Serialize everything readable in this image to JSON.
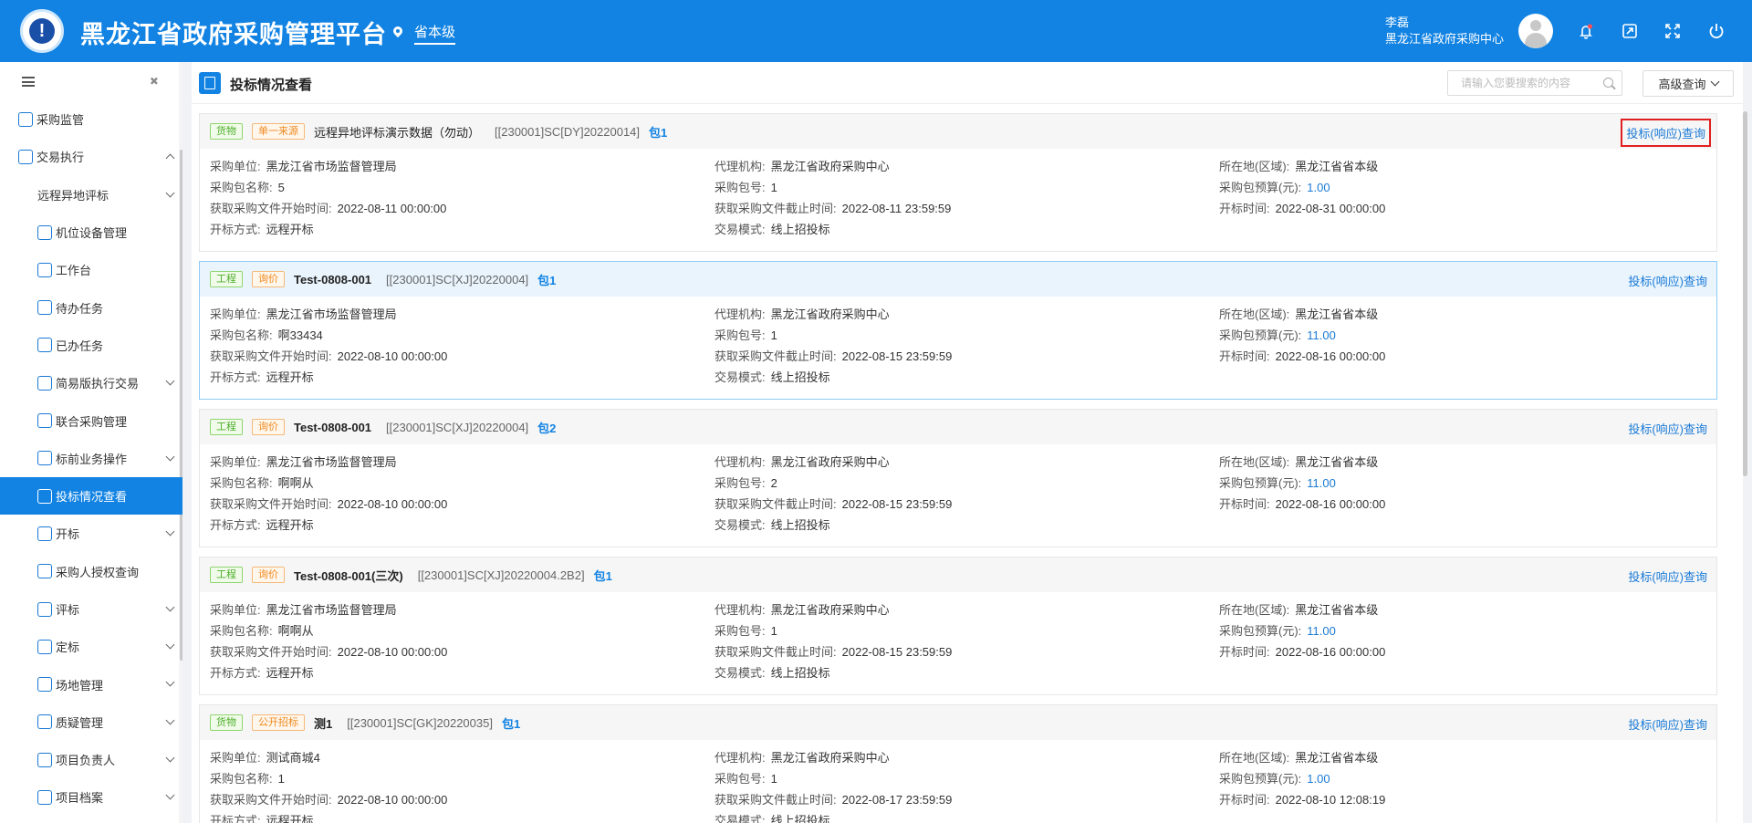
{
  "header": {
    "app_title": "黑龙江省政府采购管理平台",
    "region": "省本级",
    "user_name": "李磊",
    "user_org": "黑龙江省政府采购中心"
  },
  "sidebar": {
    "items": [
      {
        "label": "采购监管",
        "level": 0,
        "caret": ""
      },
      {
        "label": "交易执行",
        "level": 0,
        "caret": "up"
      },
      {
        "label": "远程异地评标",
        "level": 1,
        "caret": "down",
        "noicon": true
      },
      {
        "label": "机位设备管理",
        "level": 1,
        "caret": ""
      },
      {
        "label": "工作台",
        "level": 1,
        "caret": ""
      },
      {
        "label": "待办任务",
        "level": 1,
        "caret": ""
      },
      {
        "label": "已办任务",
        "level": 1,
        "caret": ""
      },
      {
        "label": "简易版执行交易",
        "level": 1,
        "caret": "down"
      },
      {
        "label": "联合采购管理",
        "level": 1,
        "caret": ""
      },
      {
        "label": "标前业务操作",
        "level": 1,
        "caret": "down"
      },
      {
        "label": "投标情况查看",
        "level": 1,
        "caret": "",
        "active": true
      },
      {
        "label": "开标",
        "level": 1,
        "caret": "down"
      },
      {
        "label": "采购人授权查询",
        "level": 1,
        "caret": ""
      },
      {
        "label": "评标",
        "level": 1,
        "caret": "down"
      },
      {
        "label": "定标",
        "level": 1,
        "caret": "down"
      },
      {
        "label": "场地管理",
        "level": 1,
        "caret": "down"
      },
      {
        "label": "质疑管理",
        "level": 1,
        "caret": "down"
      },
      {
        "label": "项目负责人",
        "level": 1,
        "caret": "down"
      },
      {
        "label": "项目档案",
        "level": 1,
        "caret": "down"
      }
    ]
  },
  "page": {
    "title": "投标情况查看",
    "search_placeholder": "请输入您要搜索的内容",
    "advanced_label": "高级查询"
  },
  "labels": {
    "unit": "采购单位:",
    "pkg_name": "采购包名称:",
    "start_time": "获取采购文件开始时间:",
    "open_mode": "开标方式:",
    "agency": "代理机构:",
    "pkg_no": "采购包号:",
    "end_time": "获取采购文件截止时间:",
    "trade_mode": "交易模式:",
    "region": "所在地(区域):",
    "budget": "采购包预算(元):",
    "open_time": "开标时间:",
    "query": "投标(响应)查询"
  },
  "cards": [
    {
      "tag1": "货物",
      "tag2": "单一来源",
      "name": "远程异地评标演示数据（勿动）",
      "code": "[[230001]SC[DY]20220014]",
      "pkg": "包1",
      "unit": "黑龙江省市场监督管理局",
      "pkg_name": "5",
      "start_time": "2022-08-11 00:00:00",
      "open_mode": "远程开标",
      "agency": "黑龙江省政府采购中心",
      "pkg_no": "1",
      "end_time": "2022-08-11 23:59:59",
      "trade_mode": "线上招投标",
      "region": "黑龙江省省本级",
      "budget": "1.00",
      "open_time": "2022-08-31 00:00:00",
      "bold": false,
      "boxed": true,
      "selected": false
    },
    {
      "tag1": "工程",
      "tag2": "询价",
      "name": "Test-0808-001",
      "code": "[[230001]SC[XJ]20220004]",
      "pkg": "包1",
      "unit": "黑龙江省市场监督管理局",
      "pkg_name": "啊33434",
      "start_time": "2022-08-10 00:00:00",
      "open_mode": "远程开标",
      "agency": "黑龙江省政府采购中心",
      "pkg_no": "1",
      "end_time": "2022-08-15 23:59:59",
      "trade_mode": "线上招投标",
      "region": "黑龙江省省本级",
      "budget": "11.00",
      "open_time": "2022-08-16 00:00:00",
      "bold": true,
      "boxed": false,
      "selected": true
    },
    {
      "tag1": "工程",
      "tag2": "询价",
      "name": "Test-0808-001",
      "code": "[[230001]SC[XJ]20220004]",
      "pkg": "包2",
      "unit": "黑龙江省市场监督管理局",
      "pkg_name": "啊啊从",
      "start_time": "2022-08-10 00:00:00",
      "open_mode": "远程开标",
      "agency": "黑龙江省政府采购中心",
      "pkg_no": "2",
      "end_time": "2022-08-15 23:59:59",
      "trade_mode": "线上招投标",
      "region": "黑龙江省省本级",
      "budget": "11.00",
      "open_time": "2022-08-16 00:00:00",
      "bold": true,
      "boxed": false,
      "selected": false
    },
    {
      "tag1": "工程",
      "tag2": "询价",
      "name": "Test-0808-001(三次)",
      "code": "[[230001]SC[XJ]20220004.2B2]",
      "pkg": "包1",
      "unit": "黑龙江省市场监督管理局",
      "pkg_name": "啊啊从",
      "start_time": "2022-08-10 00:00:00",
      "open_mode": "远程开标",
      "agency": "黑龙江省政府采购中心",
      "pkg_no": "1",
      "end_time": "2022-08-15 23:59:59",
      "trade_mode": "线上招投标",
      "region": "黑龙江省省本级",
      "budget": "11.00",
      "open_time": "2022-08-16 00:00:00",
      "bold": true,
      "boxed": false,
      "selected": false
    },
    {
      "tag1": "货物",
      "tag2": "公开招标",
      "name": "测1",
      "code": "[[230001]SC[GK]20220035]",
      "pkg": "包1",
      "unit": "测试商城4",
      "pkg_name": "1",
      "start_time": "2022-08-10 00:00:00",
      "open_mode": "远程开标",
      "agency": "黑龙江省政府采购中心",
      "pkg_no": "1",
      "end_time": "2022-08-17 23:59:59",
      "trade_mode": "线上招投标",
      "region": "黑龙江省省本级",
      "budget": "1.00",
      "open_time": "2022-08-10 12:08:19",
      "bold": true,
      "boxed": false,
      "selected": false
    }
  ]
}
